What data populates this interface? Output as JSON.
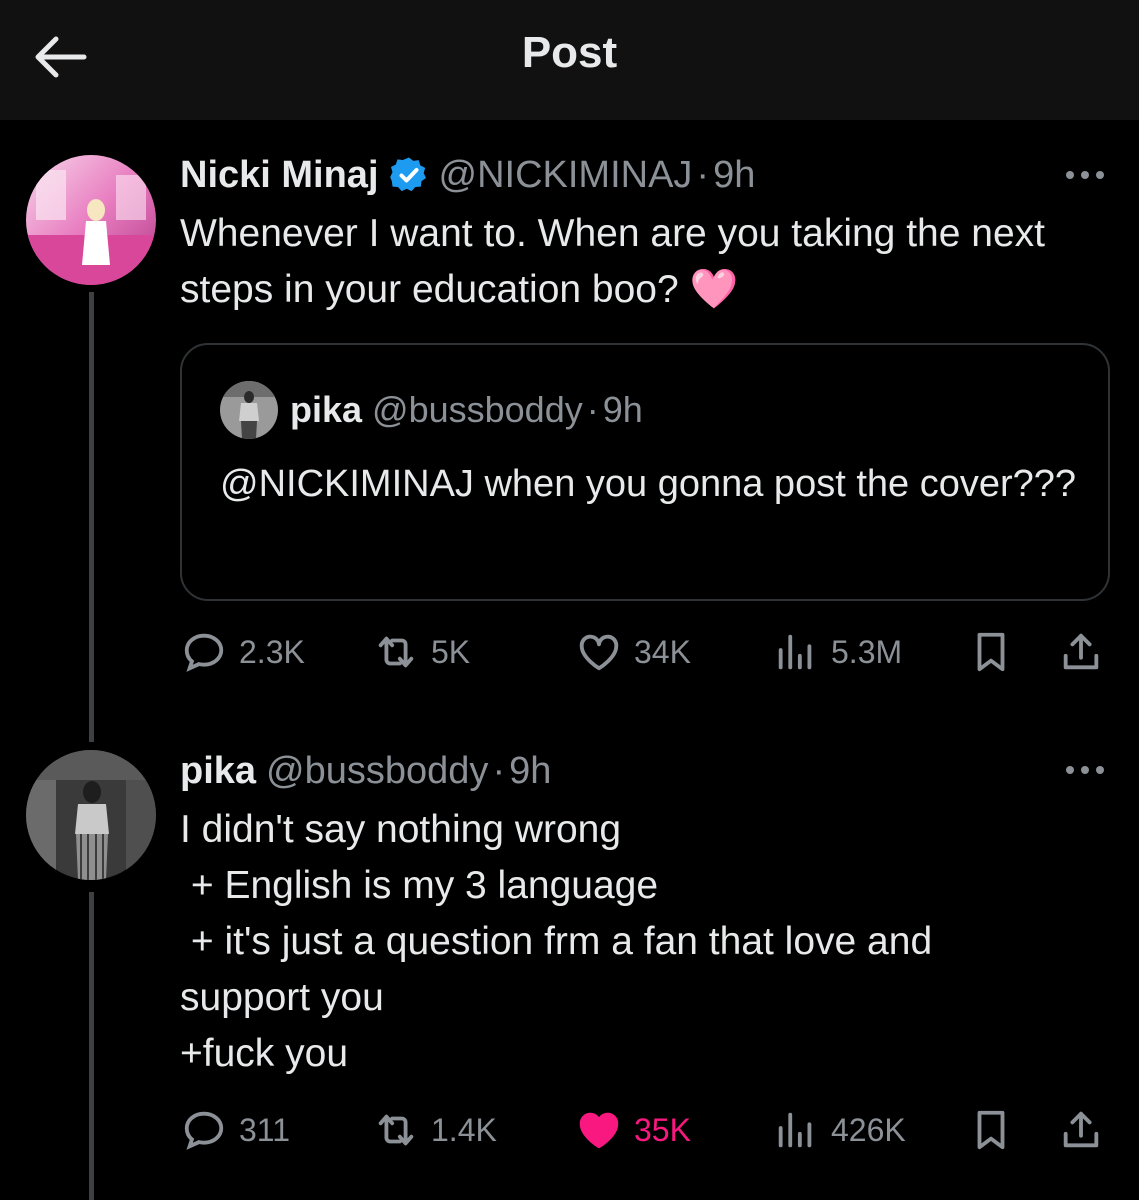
{
  "header": {
    "title": "Post"
  },
  "main_tweet": {
    "display_name": "Nicki Minaj",
    "handle": "@NICKIMINAJ",
    "separator": "·",
    "time": "9h",
    "text": "Whenever I want to. When are you taking the next steps in your education boo? 🩷",
    "quote": {
      "display_name": "pika",
      "handle": "@bussboddy",
      "separator": "·",
      "time": "9h",
      "text": "@NICKIMINAJ when you gonna post the cover???"
    },
    "stats": {
      "replies": "2.3K",
      "reposts": "5K",
      "likes": "34K",
      "views": "5.3M"
    }
  },
  "reply_tweet": {
    "display_name": "pika",
    "handle": "@bussboddy",
    "separator": "·",
    "time": "9h",
    "text": "I didn't say nothing wrong\n + English is my 3 language\n + it's just a question frm a fan that love and support you\n+fuck you",
    "stats": {
      "replies": "311",
      "reposts": "1.4K",
      "likes": "35K",
      "views": "426K"
    }
  },
  "colors": {
    "background": "#000000",
    "header_bg": "#111111",
    "text": "#e7e9ea",
    "muted": "#8b9196",
    "like_active": "#f91880",
    "verified": "#1d9bf0"
  },
  "icons": [
    "back-arrow-icon",
    "verified-badge-icon",
    "more-icon",
    "reply-icon",
    "repost-icon",
    "like-icon",
    "views-icon",
    "bookmark-icon",
    "share-icon"
  ]
}
